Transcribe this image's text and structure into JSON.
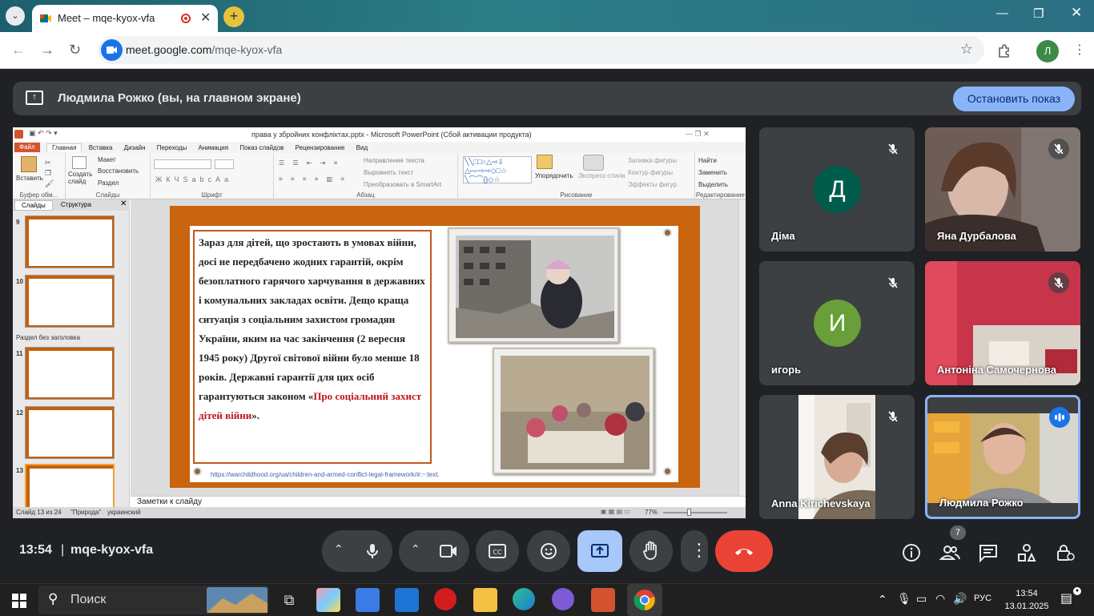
{
  "browser": {
    "tab_title": "Meet – mqe-kyox-vfa",
    "url_host": "meet.google.com",
    "url_path": "/mqe-kyox-vfa",
    "profile_initial": "Л",
    "tab_close": "✕",
    "new_tab": "+",
    "window_minimize": "—",
    "window_restore": "❐",
    "window_close": "✕"
  },
  "banner": {
    "text": "Людмила Рожко (вы, на главном экране)",
    "stop_label": "Остановить показ"
  },
  "ppt": {
    "window_title": "права у збройних конфліктах.pptx - Microsoft PowerPoint (Сбой активации продукта)",
    "file_tab": "Файл",
    "tabs": [
      "Главная",
      "Вставка",
      "Дизайн",
      "Переходы",
      "Анимация",
      "Показ слайдов",
      "Рецензирование",
      "Вид"
    ],
    "ribbon": {
      "paste": "Вставить",
      "clipboard_group": "Буфер обм...",
      "new_slide": "Создать слайд",
      "layout": "Макет",
      "reset": "Восстановить",
      "section": "Раздел",
      "slides_group": "Слайды",
      "font_group": "Шрифт",
      "text_direction": "Направление текста",
      "align_text": "Выровнять текст",
      "smartart": "Преобразовать в SmartArt",
      "paragraph_group": "Абзац",
      "arrange": "Упорядочить",
      "quick_styles": "Экспресс-стили",
      "shape_fill": "Заливка фигуры",
      "shape_outline": "Контур фигуры",
      "shape_effects": "Эффекты фигур",
      "drawing_group": "Рисование",
      "find": "Найти",
      "replace": "Заменить",
      "select": "Выделить",
      "editing_group": "Редактирование"
    },
    "panel_tabs": [
      "Слайды",
      "Структура"
    ],
    "section_label": "Раздел без заголовка",
    "thumb_numbers": [
      "9",
      "10",
      "11",
      "12",
      "13"
    ],
    "slide_text_parts": [
      "Зараз для дітей, що зростають в умовах війни, досі не передбачено жодних гарантій, окрім безоплатного гарячого харчування в державних і комунальних закладах освіти. Дещо краща ситуація з соціальним захистом громадян України, яким на час закінчення (2 вересня 1945 року) Другої світової війни було менше 18 років. Державні гарантії для цих осіб гарантуються законом «",
      "Про соціальний захист дітей війни",
      "»."
    ],
    "slide_link": "https://warchildhood.org/ua/children-and-armed-conflict-legal-framework/#:~:text.",
    "notes_placeholder": "Заметки к слайду",
    "status_slide": "Слайд 13 из 24",
    "status_theme": "\"Природа\"",
    "status_lang": "украинский",
    "zoom": "77%"
  },
  "participants": [
    {
      "name": "Діма",
      "initial": "Д",
      "color": "#005c4b",
      "muted": true,
      "video": false
    },
    {
      "name": "Яна Дурбалова",
      "muted": true,
      "video": true
    },
    {
      "name": "игорь",
      "initial": "И",
      "color": "#689f38",
      "muted": true,
      "video": false
    },
    {
      "name": "Антоніна Самочернова",
      "muted": true,
      "video": true
    },
    {
      "name": "Anna Kirichevskaya",
      "muted": true,
      "video": true
    },
    {
      "name": "Людмила Рожко",
      "muted": false,
      "video": true,
      "speaking": true
    }
  ],
  "meeting": {
    "time": "13:54",
    "code": "mqe-kyox-vfa",
    "participant_count": "7"
  },
  "taskbar": {
    "search_label": "Поиск",
    "lang": "РУС",
    "clock_time": "13:54",
    "clock_date": "13.01.2025"
  }
}
